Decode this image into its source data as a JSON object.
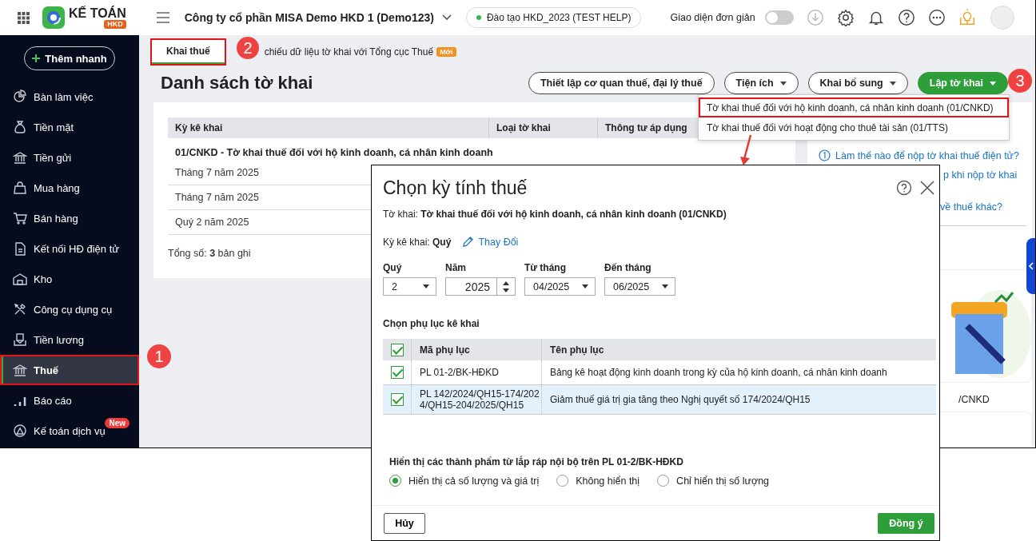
{
  "header": {
    "logo_text": "KẾ TOÁN",
    "logo_badge": "HKD",
    "company": "Công ty cổ phần MISA Demo HKD 1 (Demo123)",
    "database": "Đào tạo HKD_2023 (TEST HELP)",
    "simple_mode": {
      "label": "Giao diện đơn giản",
      "on": false
    }
  },
  "sidebar": {
    "add_button": "Thêm nhanh",
    "items": [
      {
        "label": "Bàn làm việc",
        "selected": false,
        "annotated": false
      },
      {
        "label": "Tiền mặt",
        "selected": false,
        "annotated": false
      },
      {
        "label": "Tiền gửi",
        "selected": false,
        "annotated": false
      },
      {
        "label": "Mua hàng",
        "selected": false,
        "annotated": false
      },
      {
        "label": "Bán hàng",
        "selected": false,
        "annotated": false
      },
      {
        "label": "Kết nối HĐ điện tử",
        "selected": false,
        "annotated": false
      },
      {
        "label": "Kho",
        "selected": false,
        "annotated": false
      },
      {
        "label": "Công cụ dụng cụ",
        "selected": false,
        "annotated": false
      },
      {
        "label": "Tiền lương",
        "selected": false,
        "annotated": false
      },
      {
        "label": "Thuế",
        "selected": true,
        "annotated": true
      },
      {
        "label": "Báo cáo",
        "selected": false,
        "annotated": false
      },
      {
        "label": "Kế toán dịch vụ",
        "selected": false,
        "annotated": false,
        "badge": "New"
      }
    ]
  },
  "tabs": [
    {
      "label": "Khai thuế",
      "selected": true,
      "annotated": true
    },
    {
      "label": "chiếu dữ liệu tờ khai với Tổng cục Thuế",
      "selected": false,
      "annotated": false,
      "badge": "Mới"
    }
  ],
  "page_title": "Danh sách tờ khai",
  "toolbar": [
    {
      "label": "Thiết lập cơ quan thuế, đại lý thuế",
      "kind": "plain"
    },
    {
      "label": "Tiện ích",
      "kind": "dropdown"
    },
    {
      "label": "Khai bổ sung",
      "kind": "dropdown"
    },
    {
      "label": "Lập tờ khai",
      "kind": "primary"
    }
  ],
  "create_menu": [
    {
      "label": "Tờ khai thuế đối với hộ kinh doanh, cá nhân kinh doanh (01/CNKD)",
      "annotated": true
    },
    {
      "label": "Tờ khai thuế đối với hoạt động cho thuê tài sản (01/TTS)",
      "annotated": false
    }
  ],
  "annotations": [
    {
      "label": "1"
    },
    {
      "label": "2"
    },
    {
      "label": "3"
    }
  ],
  "table": {
    "columns": [
      "Kỳ kê khai",
      "Loại tờ khai",
      "Thông tư áp dụng"
    ],
    "group": "01/CNKD - Tờ khai thuế đối với hộ kinh doanh, cá nhân kinh doanh",
    "rows": [
      "Tháng 7 năm 2025",
      "Tháng 7 năm 2025",
      "Quý 2 năm 2025"
    ],
    "total": "Tổng số: **3** bản ghi"
  },
  "help_panel": {
    "links": [
      "Làm thế nào để nộp tờ khai thuế điện tử?",
      "p khi nộp tờ khai",
      "về thuế khác?"
    ],
    "card_caption": "/CNKD"
  },
  "dialog": {
    "title": "Chọn kỳ tính thuế",
    "declaration": "Tờ khai: **Tờ khai thuế đối với hộ kinh doanh, cá nhân kinh doanh (01/CNKD)**",
    "period_type": "Kỳ kê khai: **Quý**",
    "change_link": "Thay Đổi",
    "fields": [
      {
        "label": "Quý",
        "value": "2",
        "kind": "select"
      },
      {
        "label": "Năm",
        "value": "2025",
        "kind": "spinner"
      },
      {
        "label": "Từ tháng",
        "value": "04/2025",
        "kind": "select"
      },
      {
        "label": "Đến tháng",
        "value": "06/2025",
        "kind": "select"
      }
    ],
    "appendix": {
      "heading": "Chọn phụ lục kê khai",
      "all_checked": true,
      "columns": [
        "Mã phụ lục",
        "Tên phụ lục"
      ],
      "rows": [
        {
          "code": "PL 01-2/BK-HĐKD",
          "name": "Bảng kê hoạt động kinh doanh trong kỳ của hộ kinh doanh, cá nhân kinh doanh",
          "checked": true,
          "selected": false
        },
        {
          "code": "PL 142/2024/QH15-174/2024/QH15-204/2025/QH15",
          "name": "Giảm thuế giá trị gia tăng theo Nghị quyết số 174/2024/QH15",
          "checked": true,
          "selected": true
        }
      ]
    },
    "display": {
      "heading": "Hiển thị các thành phẩm từ lắp ráp nội bộ trên PL 01-2/BK-HĐKD",
      "options": [
        {
          "label": "Hiển thị cả số lượng và giá trị",
          "selected": true
        },
        {
          "label": "Không hiển thị",
          "selected": false
        },
        {
          "label": "Chỉ hiển thị số lượng",
          "selected": false
        }
      ]
    },
    "cancel": "Hủy",
    "ok": "Đồng ý"
  }
}
